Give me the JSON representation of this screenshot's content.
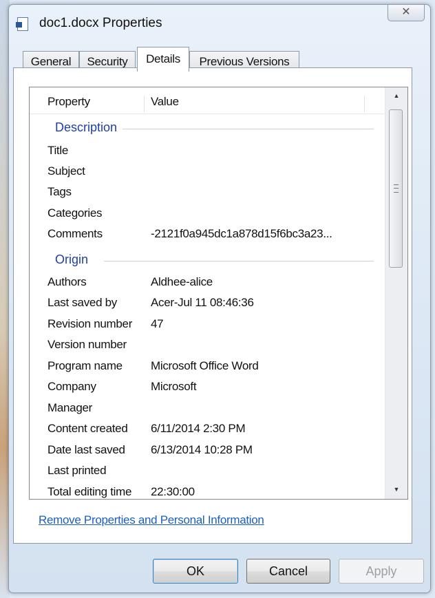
{
  "window": {
    "title": "doc1.docx Properties",
    "close_glyph": "✕"
  },
  "tabs": [
    {
      "label": "General",
      "active": false
    },
    {
      "label": "Security",
      "active": false
    },
    {
      "label": "Details",
      "active": true
    },
    {
      "label": "Previous Versions",
      "active": false
    }
  ],
  "details": {
    "columns": {
      "property": "Property",
      "value": "Value"
    },
    "groups": {
      "description": {
        "label": "Description",
        "rows": [
          {
            "name": "Title",
            "value": ""
          },
          {
            "name": "Subject",
            "value": ""
          },
          {
            "name": "Tags",
            "value": ""
          },
          {
            "name": "Categories",
            "value": ""
          },
          {
            "name": "Comments",
            "value": "-2121f0a945dc1a878d15f6bc3a23..."
          }
        ]
      },
      "origin": {
        "label": "Origin",
        "rows": [
          {
            "name": "Authors",
            "value": "Aldhee-alice"
          },
          {
            "name": "Last saved by",
            "value": "Acer-Jul 11 08:46:36"
          },
          {
            "name": "Revision number",
            "value": "47"
          },
          {
            "name": "Version number",
            "value": ""
          },
          {
            "name": "Program name",
            "value": "Microsoft Office Word"
          },
          {
            "name": "Company",
            "value": "Microsoft"
          },
          {
            "name": "Manager",
            "value": ""
          },
          {
            "name": "Content created",
            "value": "6/11/2014 2:30 PM"
          },
          {
            "name": "Date last saved",
            "value": "6/13/2014 10:28 PM"
          },
          {
            "name": "Last printed",
            "value": ""
          },
          {
            "name": "Total editing time",
            "value": "22:30:00"
          }
        ]
      }
    }
  },
  "remove_link": "Remove Properties and Personal Information",
  "buttons": {
    "ok": "OK",
    "cancel": "Cancel",
    "apply": "Apply"
  },
  "icons": {
    "document": "word-document-icon",
    "close": "close-icon"
  },
  "colors": {
    "group_header": "#1f3fa8",
    "link": "#1a5fbf",
    "panel_bg": "#ffffff"
  }
}
